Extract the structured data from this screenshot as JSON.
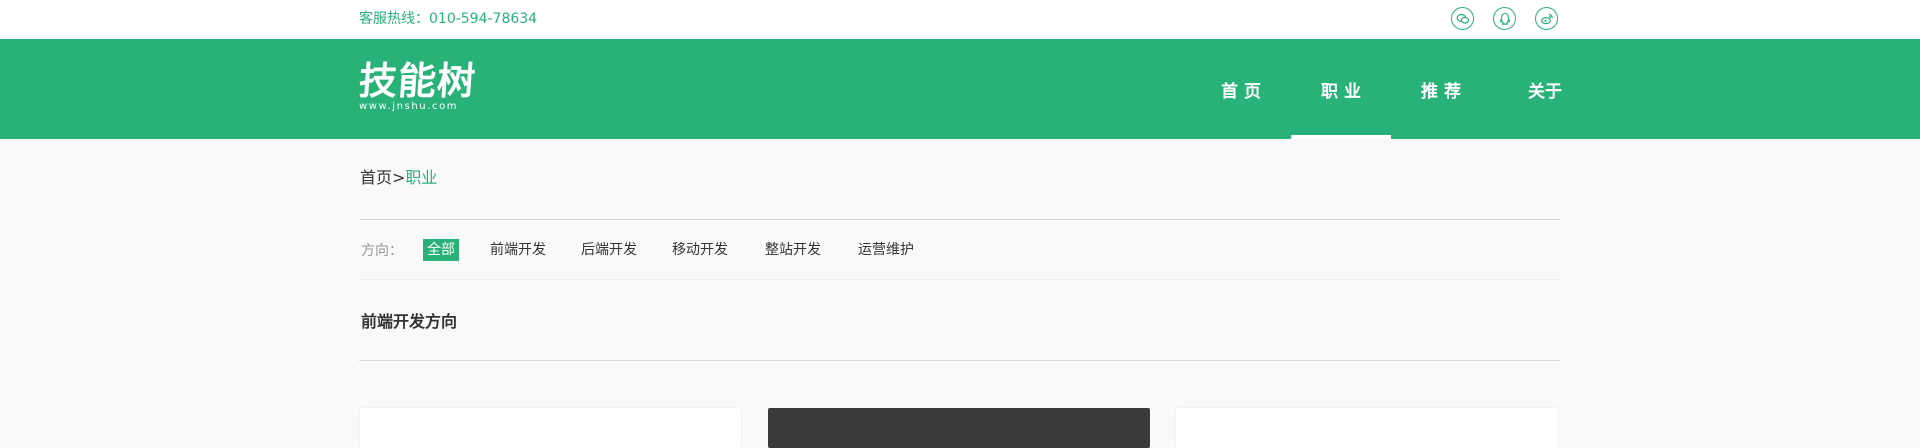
{
  "topbar": {
    "hotline": "客服热线：010-594-78634",
    "social_icons": [
      "wechat-icon",
      "qq-icon",
      "weibo-icon"
    ]
  },
  "header": {
    "logo_main": "技能树",
    "logo_sub": "www.jnshu.com",
    "nav": [
      {
        "label": "首 页",
        "active": false
      },
      {
        "label": "职 业",
        "active": true
      },
      {
        "label": "推 荐",
        "active": false
      },
      {
        "label": "关于",
        "active": false
      }
    ]
  },
  "breadcrumb": {
    "home": "首页",
    "separator": ">",
    "current": "职业"
  },
  "filters": {
    "label": "方向：",
    "items": [
      {
        "label": "全部",
        "active": true
      },
      {
        "label": "前端开发",
        "active": false
      },
      {
        "label": "后端开发",
        "active": false
      },
      {
        "label": "移动开发",
        "active": false
      },
      {
        "label": "整站开发",
        "active": false
      },
      {
        "label": "运营维护",
        "active": false
      }
    ]
  },
  "section": {
    "title": "前端开发方向"
  },
  "colors": {
    "brand": "#29b278",
    "page_bg": "#f9f9f9",
    "dark_card": "#3a3a3a"
  }
}
